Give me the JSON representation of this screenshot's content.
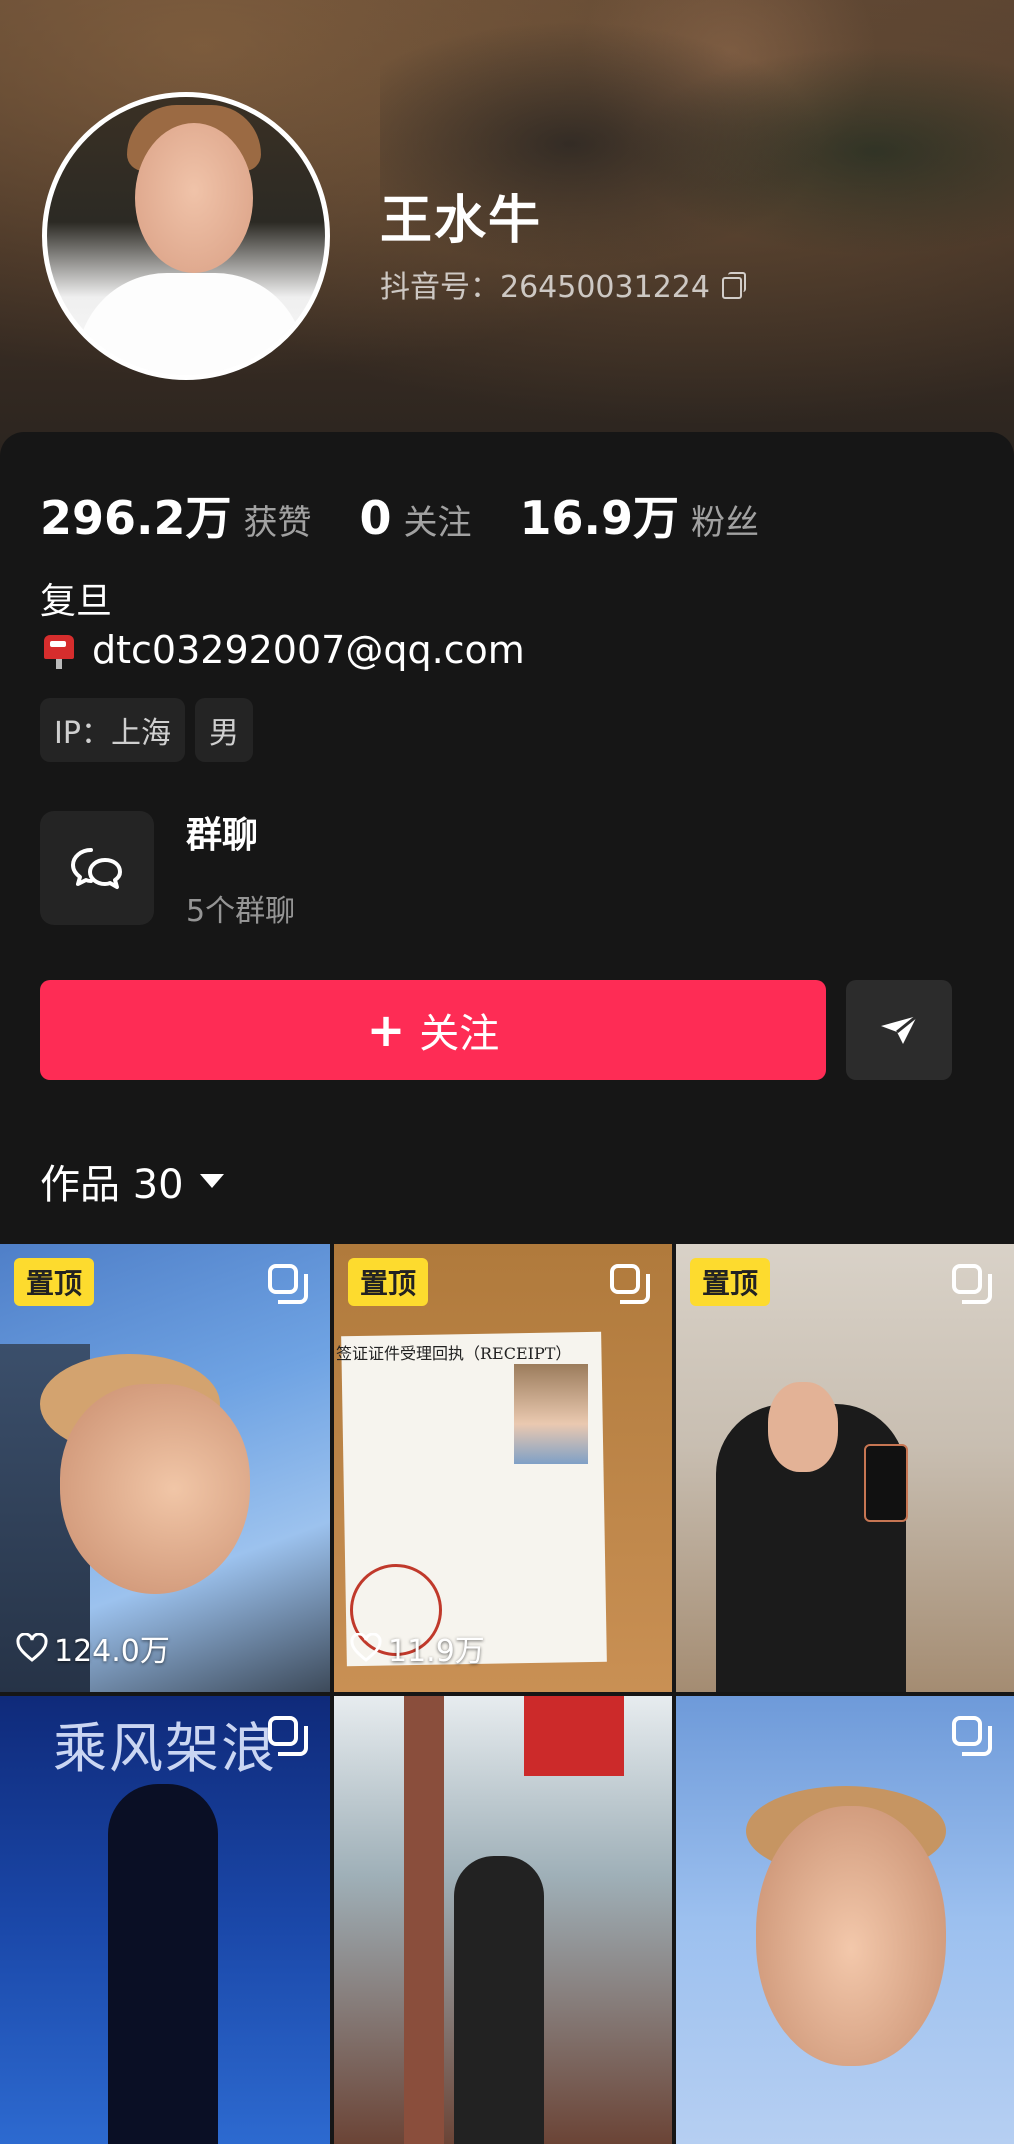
{
  "profile": {
    "name": "王水牛",
    "douyin_id": "抖音号：26450031224",
    "stats": [
      {
        "value": "296.2万",
        "label": "获赞"
      },
      {
        "value": "0",
        "label": "关注"
      },
      {
        "value": "16.9万",
        "label": "粉丝"
      }
    ],
    "school": "复旦",
    "email": "dtc03292007@qq.com",
    "tags": [
      "IP：上海",
      "男"
    ]
  },
  "group_chat": {
    "title": "群聊",
    "subtitle": "5个群聊"
  },
  "actions": {
    "follow_label": "关注",
    "follow_plus": "+"
  },
  "works": {
    "label": "作品 30"
  },
  "tiles": [
    {
      "pinned": true,
      "pin_label": "置顶",
      "likes": "124.0万"
    },
    {
      "pinned": true,
      "pin_label": "置顶",
      "likes": "11.9万",
      "doc_title": "签证证件受理回执（RECEIPT）"
    },
    {
      "pinned": true,
      "pin_label": "置顶"
    },
    {
      "pinned": false,
      "banner_text": "乘风架浪"
    },
    {
      "pinned": false
    },
    {
      "pinned": false
    }
  ],
  "colors": {
    "follow": "#fe2c55",
    "pin": "#fddb2e",
    "background": "#161616"
  }
}
